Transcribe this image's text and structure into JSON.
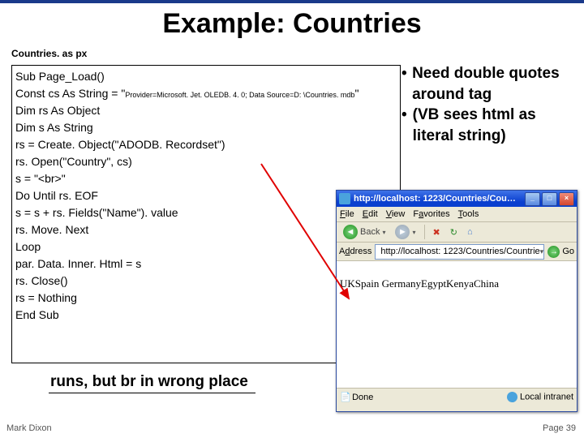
{
  "slide": {
    "title": "Example: Countries",
    "filename": "Countries. as px",
    "caption": "runs, but br in wrong place",
    "footer_left": "Mark Dixon",
    "footer_right": "Page 39"
  },
  "code": {
    "l1": "Sub Page_Load()",
    "l2a": " Const cs As String = \"",
    "l2b": "Provider=Microsoft. Jet. OLEDB. 4. 0; Data Source=D: \\Countries. mdb",
    "l2c": "\"",
    "l3": " Dim rs As Object",
    "l4": " Dim s As String",
    "l5": "   rs = Create. Object(\"ADODB. Recordset\")",
    "l6": "   rs. Open(\"Country\", cs)",
    "l7": "   s = \"<br>\"",
    "l8": "   Do Until rs. EOF",
    "l9": "     s = s + rs. Fields(\"Name\"). value",
    "l10": "     rs. Move. Next",
    "l11": "   Loop",
    "l12": "   par. Data. Inner. Html = s",
    "l13": "   rs. Close()",
    "l14": "   rs = Nothing",
    "l15": "End Sub"
  },
  "bullets": {
    "b1": "Need double quotes around tag",
    "b2": "(VB sees html as literal string)"
  },
  "browser": {
    "title": "http://localhost: 1223/Countries/Cou…",
    "menu": {
      "file": "File",
      "edit": "Edit",
      "view": "View",
      "favorites": "Favorites",
      "tools": "Tools"
    },
    "toolbar": {
      "back": "Back",
      "forward": "▶"
    },
    "address_label": "Address",
    "url": "http://localhost: 1223/Countries/Countrie",
    "go": "Go",
    "body": "UKSpain GermanyEgyptKenyaChina",
    "status_left": "Done",
    "status_right": "Local intranet",
    "btn_min": "_",
    "btn_max": "□",
    "btn_close": "×"
  }
}
